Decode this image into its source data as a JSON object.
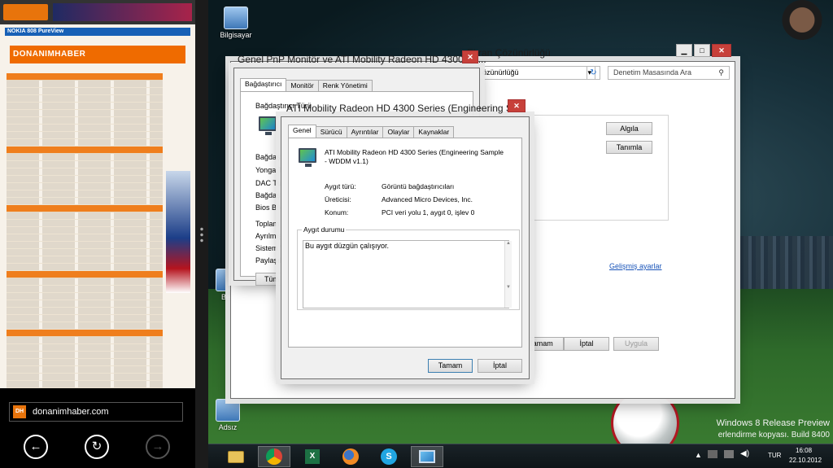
{
  "browser": {
    "url": "donanimhaber.com",
    "favicon": "DH",
    "site_brand": "DONANIMHABER",
    "nokia_banner": "NOKIA   808 PureView",
    "back": "back-arrow-icon",
    "refresh": "refresh-icon",
    "forward": "forward-arrow-icon"
  },
  "desktop": {
    "icons": [
      {
        "label": "Bilgisayar"
      },
      {
        "label": "Ben"
      },
      {
        "label": "Adsız"
      }
    ],
    "watermark": {
      "line1": "Windows 8 Release Preview",
      "line2": "erlendirme kopyası. Build 8400"
    }
  },
  "screen_window": {
    "title": "Ekran Çözünürlüğü",
    "address_tail": "özünürlüğü",
    "search_placeholder": "Denetim Masasında Ara",
    "detect": "Algıla",
    "identify": "Tanımla",
    "advanced_link": "Gelişmiş ayarlar",
    "ok": "Tamam",
    "cancel": "İptal",
    "apply": "Uygula"
  },
  "pnp_window": {
    "title": "Genel PnP Monitör ve ATI Mobility Radeon HD 4300 Se...",
    "tabs": [
      "Bağdaştırıcı",
      "Monitör",
      "Renk Yönetimi"
    ],
    "adapter_type_label": "Bağdaştırıcı Türü",
    "info_labels": [
      "Bağdaştı",
      "Yonga T",
      "DAC Tür",
      "Bağdaştı",
      "Bios Bilgi",
      "Toplam K",
      "Ayrılmış",
      "Sistem V",
      "Paylaşıla"
    ],
    "list_all_modes": "Tüm M"
  },
  "ati_window": {
    "title": "ATI Mobility Radeon HD 4300 Series (Engineering Sa...",
    "tabs": [
      "Genel",
      "Sürücü",
      "Ayrıntılar",
      "Olaylar",
      "Kaynaklar"
    ],
    "device_name": "ATI Mobility Radeon HD 4300 Series (Engineering Sample - WDDM v1.1)",
    "fields": [
      {
        "key": "Aygıt türü:",
        "value": "Görüntü bağdaştırıcıları"
      },
      {
        "key": "Üreticisi:",
        "value": "Advanced Micro Devices, Inc."
      },
      {
        "key": "Konum:",
        "value": "PCI veri yolu 1, aygıt 0, işlev 0"
      }
    ],
    "status_group": "Aygıt durumu",
    "status_text": "Bu aygıt düzgün çalışıyor.",
    "ok": "Tamam",
    "cancel": "İptal"
  },
  "taskbar": {
    "apps": [
      "explorer-icon",
      "chrome-icon",
      "excel-icon",
      "firefox-icon",
      "skype-icon",
      "display-icon"
    ],
    "language": "TUR",
    "time": "16:08",
    "date": "22.10.2012"
  }
}
